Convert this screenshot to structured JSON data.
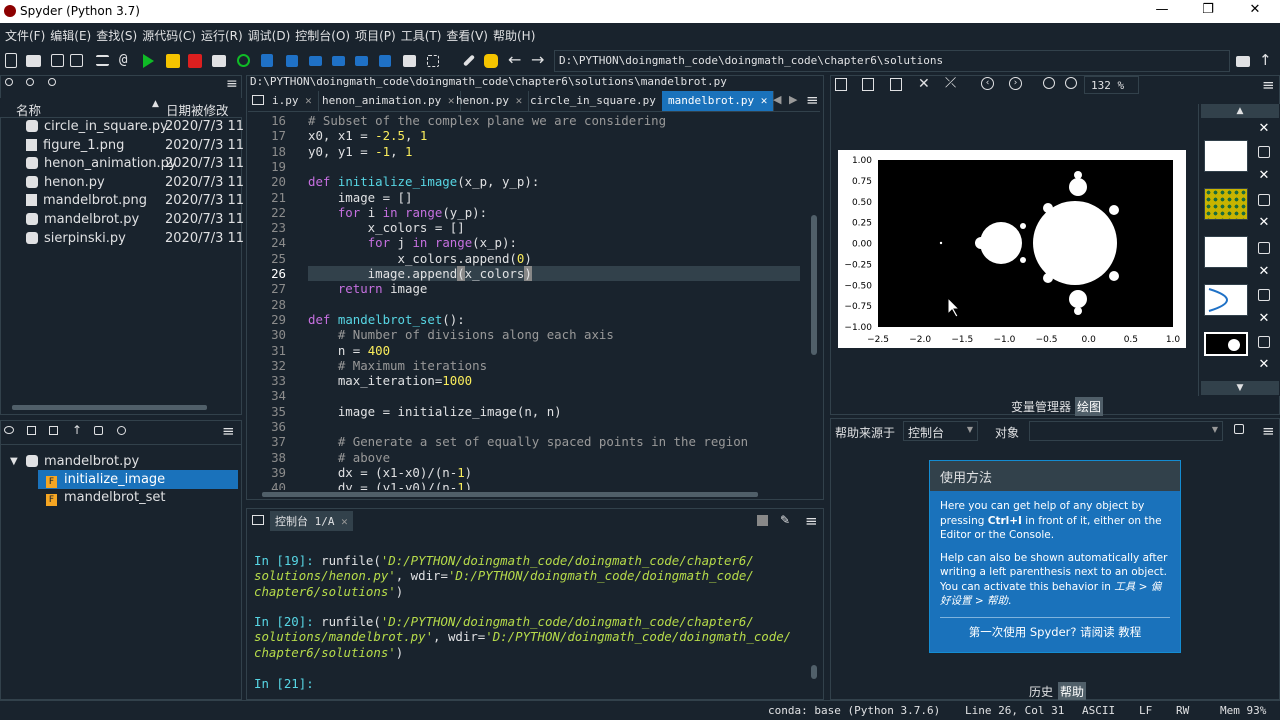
{
  "window": {
    "title": "Spyder (Python 3.7)"
  },
  "menu": [
    "文件(F)",
    "编辑(E)",
    "查找(S)",
    "源代码(C)",
    "运行(R)",
    "调试(D)",
    "控制台(O)",
    "项目(P)",
    "工具(T)",
    "查看(V)",
    "帮助(H)"
  ],
  "toolbar": {
    "path": "D:\\PYTHON\\doingmath_code\\doingmath_code\\chapter6\\solutions"
  },
  "filebrowser": {
    "col_name": "名称",
    "col_date": "日期被修改",
    "files": [
      {
        "name": "circle_in_square.py",
        "date": "2020/7/3 11",
        "type": "py"
      },
      {
        "name": "figure_1.png",
        "date": "2020/7/3 11",
        "type": "png"
      },
      {
        "name": "henon_animation.py",
        "date": "2020/7/3 11",
        "type": "py"
      },
      {
        "name": "henon.py",
        "date": "2020/7/3 11",
        "type": "py"
      },
      {
        "name": "mandelbrot.png",
        "date": "2020/7/3 11",
        "type": "png"
      },
      {
        "name": "mandelbrot.py",
        "date": "2020/7/3 11",
        "type": "py"
      },
      {
        "name": "sierpinski.py",
        "date": "2020/7/3 11",
        "type": "py"
      }
    ]
  },
  "outline": {
    "root": "mandelbrot.py",
    "items": [
      "initialize_image",
      "mandelbrot_set"
    ]
  },
  "editor": {
    "filepath": "D:\\PYTHON\\doingmath_code\\doingmath_code\\chapter6\\solutions\\mandelbrot.py",
    "tabs": [
      "i.py",
      "henon_animation.py",
      "henon.py",
      "circle_in_square.py",
      "mandelbrot.py"
    ],
    "active_tab": 4,
    "line_numbers": [
      "16",
      "17",
      "18",
      "19",
      "20",
      "21",
      "22",
      "23",
      "24",
      "25",
      "26",
      "27",
      "28",
      "29",
      "30",
      "31",
      "32",
      "33",
      "34",
      "35",
      "36",
      "37",
      "38",
      "39",
      "40"
    ]
  },
  "console": {
    "tab": "控制台 1/A",
    "p1": "In [19]:",
    "cmd1a": " runfile(",
    "str1a": "'D:/PYTHON/doingmath_code/doingmath_code/chapter6/",
    "str1b": "solutions/henon.py'",
    "mid1": ", wdir=",
    "str1c": "'D:/PYTHON/doingmath_code/doingmath_code/",
    "str1d": "chapter6/solutions'",
    "end1": ")",
    "p2": "In [20]:",
    "cmd2a": " runfile(",
    "str2a": "'D:/PYTHON/doingmath_code/doingmath_code/chapter6/",
    "str2b": "solutions/mandelbrot.py'",
    "mid2": ", wdir=",
    "str2c": "'D:/PYTHON/doingmath_code/doingmath_code/",
    "str2d": "chapter6/solutions'",
    "end2": ")",
    "p3": "In [21]:"
  },
  "plots": {
    "zoom": "132 %",
    "tabs": [
      "变量管理器",
      "绘图"
    ],
    "x_ticks": [
      "−2.5",
      "−2.0",
      "−1.5",
      "−1.0",
      "−0.5",
      "0.0",
      "0.5",
      "1.0"
    ],
    "y_ticks": [
      "1.00",
      "0.75",
      "0.50",
      "0.25",
      "0.00",
      "−0.25",
      "−0.50",
      "−0.75",
      "−1.00"
    ]
  },
  "help": {
    "source_label": "帮助来源于",
    "source_value": "控制台",
    "object_label": "对象",
    "box_title": "使用方法",
    "p1a": "Here you can get help of any object by pressing ",
    "p1b": "Ctrl+I",
    "p1c": " in front of it, either on the Editor or the Console.",
    "p2a": "Help can also be shown automatically after writing a left parenthesis next to an object. You can activate this behavior in ",
    "p2b": "工具 > 偏好设置 > 帮助",
    "p2c": ".",
    "footer": "第一次使用 Spyder? 请阅读 教程",
    "tabs": [
      "历史",
      "帮助"
    ]
  },
  "status": {
    "conda": "conda: base (Python 3.7.6)",
    "pos": "Line 26, Col 31",
    "enc": "ASCII",
    "eol": "LF",
    "rw": "RW",
    "mem": "Mem 93%"
  }
}
